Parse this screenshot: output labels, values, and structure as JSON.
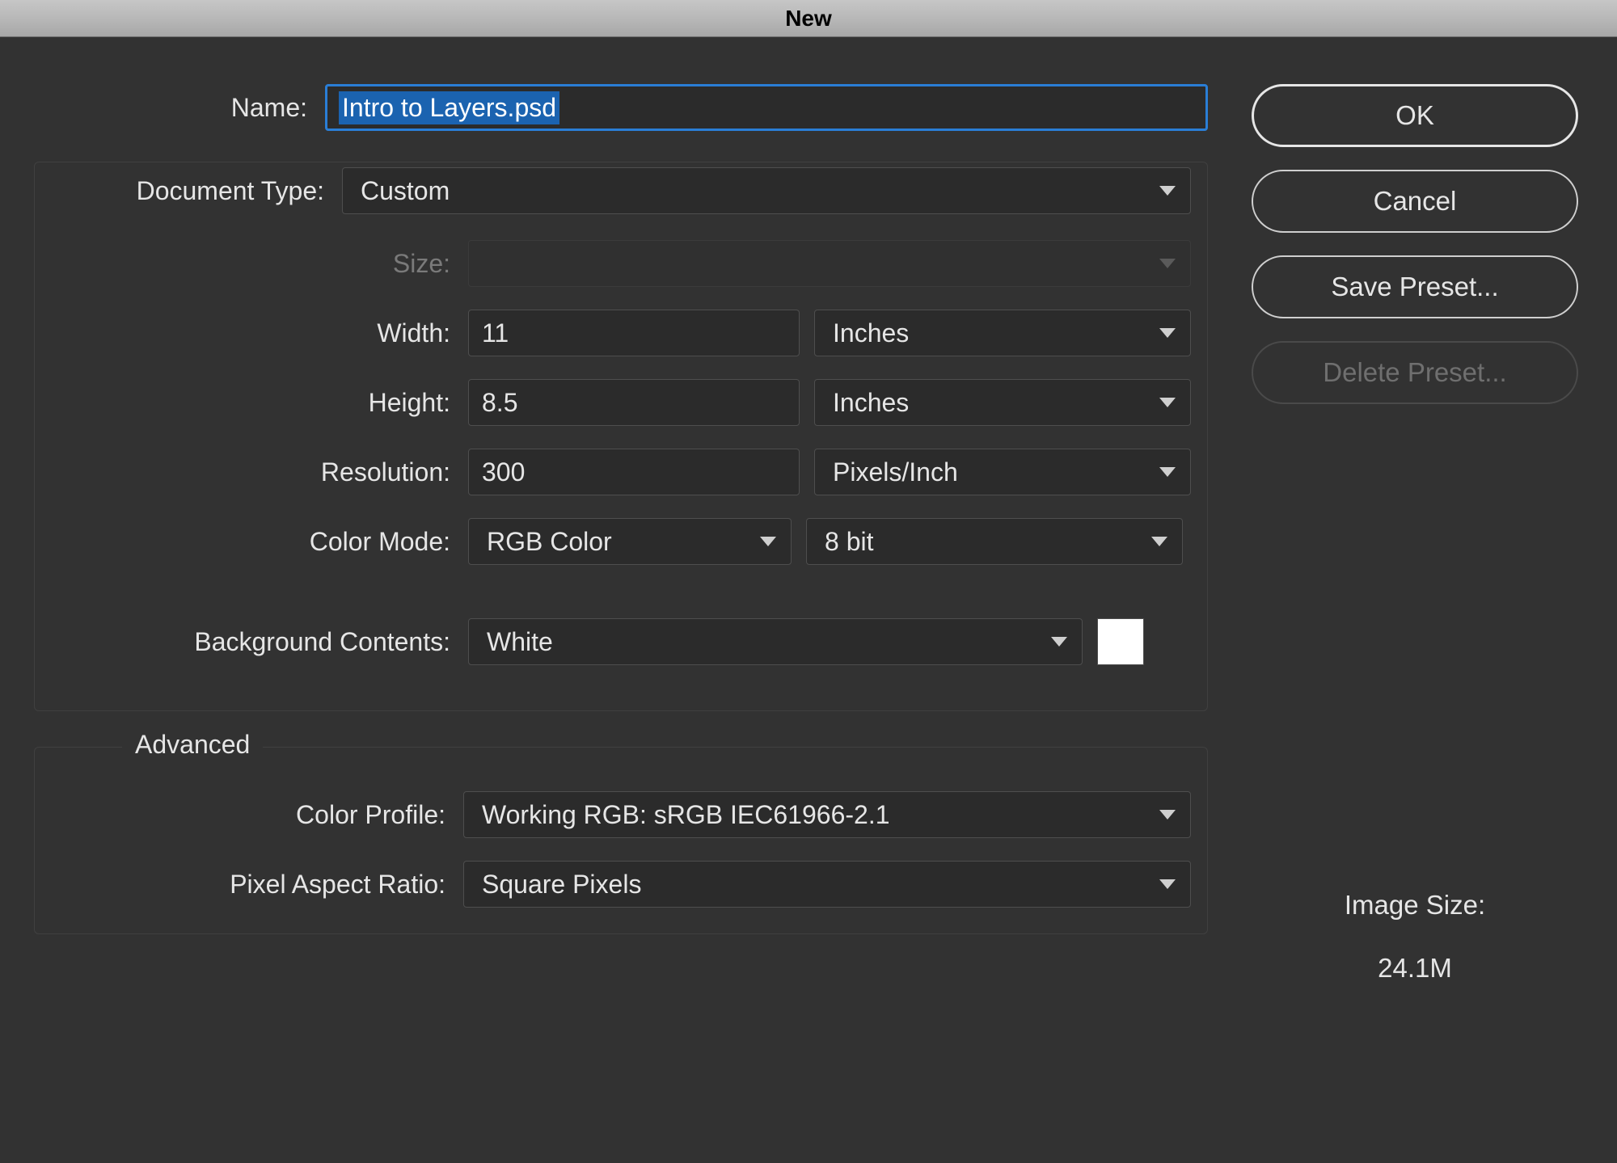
{
  "title": "New",
  "labels": {
    "name": "Name:",
    "doc_type": "Document Type:",
    "size": "Size:",
    "width": "Width:",
    "height": "Height:",
    "resolution": "Resolution:",
    "color_mode": "Color Mode:",
    "bg_contents": "Background Contents:",
    "advanced": "Advanced",
    "color_profile": "Color Profile:",
    "pixel_aspect": "Pixel Aspect Ratio:",
    "image_size": "Image Size:"
  },
  "fields": {
    "name_value": "Intro to Layers.psd",
    "doc_type_value": "Custom",
    "size_value": "",
    "width_value": "11",
    "width_unit": "Inches",
    "height_value": "8.5",
    "height_unit": "Inches",
    "resolution_value": "300",
    "resolution_unit": "Pixels/Inch",
    "color_mode_value": "RGB Color",
    "color_depth_value": "8 bit",
    "bg_contents_value": "White",
    "bg_swatch_color": "#ffffff",
    "color_profile_value": "Working RGB:  sRGB IEC61966-2.1",
    "pixel_aspect_value": "Square Pixels"
  },
  "image_size_value": "24.1M",
  "buttons": {
    "ok": "OK",
    "cancel": "Cancel",
    "save_preset": "Save Preset...",
    "delete_preset": "Delete Preset..."
  }
}
